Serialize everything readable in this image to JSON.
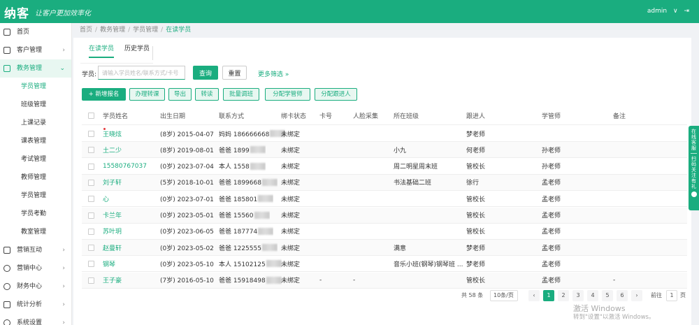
{
  "header": {
    "logo": "纳客",
    "slogan": "让客户更加效率化",
    "user": "admin",
    "user_arrow": "∨",
    "exit_icon": "⇥"
  },
  "sidebar": [
    {
      "label": "首页",
      "icon": "home-icon",
      "arrow": ""
    },
    {
      "label": "客户管理",
      "icon": "customer-icon",
      "arrow": "›"
    },
    {
      "label": "教务管理",
      "icon": "education-icon",
      "arrow": "⌄",
      "open": true,
      "children": [
        "学员管理",
        "班级管理",
        "上课记录",
        "课表管理",
        "考试管理",
        "教师管理",
        "学员管理",
        "学员考勤",
        "教室管理"
      ]
    },
    {
      "label": "营销互动",
      "icon": "marketing-icon",
      "arrow": "›"
    },
    {
      "label": "营销中心",
      "icon": "gift-icon",
      "arrow": "›"
    },
    {
      "label": "财务中心",
      "icon": "finance-icon",
      "arrow": "›"
    },
    {
      "label": "统计分析",
      "icon": "chart-icon",
      "arrow": "›"
    },
    {
      "label": "系统设置",
      "icon": "settings-icon",
      "arrow": "›"
    }
  ],
  "breadcrumb": [
    "首页",
    "教务管理",
    "学员管理",
    "在读学员"
  ],
  "tabs": [
    "在读学员",
    "历史学员"
  ],
  "search": {
    "label": "学员:",
    "placeholder": "请输入学员姓名/联系方式/卡号",
    "query": "查询",
    "reset": "重置",
    "more": "更多筛选 »"
  },
  "actions": [
    "+ 新增报名",
    "办理转课",
    "导出",
    "转读",
    "批量调班",
    "分配学管师",
    "分配跟进人"
  ],
  "columns": [
    "学员姓名",
    "出生日期",
    "联系方式",
    "绑卡状态",
    "卡号",
    "人脸采集",
    "所在班级",
    "跟进人",
    "学管师",
    "备注"
  ],
  "rows": [
    {
      "name": "王晓炫",
      "birth": "(8岁) 2015-04-07",
      "contact": "妈妈 186666668",
      "bind": "未绑定",
      "card": "",
      "face": "",
      "class": "",
      "follow": "梦老师",
      "manager": "",
      "remark": ""
    },
    {
      "name": "土二少",
      "birth": "(8岁) 2019-08-01",
      "contact": "爸爸 1899",
      "bind": "未绑定",
      "card": "",
      "face": "",
      "class": "小九",
      "follow": "何老师",
      "manager": "孙老师",
      "remark": ""
    },
    {
      "name": "15580767037",
      "birth": "(0岁) 2023-07-04",
      "contact": "本人 1558",
      "bind": "未绑定",
      "card": "",
      "face": "",
      "class": "周二明星周末班",
      "follow": "管校长",
      "manager": "孙老师",
      "remark": ""
    },
    {
      "name": "刘子轩",
      "birth": "(5岁) 2018-10-01",
      "contact": "爸爸 1899668",
      "bind": "未绑定",
      "card": "",
      "face": "",
      "class": "书法基础二班",
      "follow": "徐行",
      "manager": "孟老师",
      "remark": ""
    },
    {
      "name": "心",
      "birth": "(0岁) 2023-07-01",
      "contact": "爸爸 185801",
      "bind": "未绑定",
      "card": "",
      "face": "",
      "class": "",
      "follow": "管校长",
      "manager": "孟老师",
      "remark": ""
    },
    {
      "name": "卡兰年",
      "birth": "(0岁) 2023-05-01",
      "contact": "爸爸 15560",
      "bind": "未绑定",
      "card": "",
      "face": "",
      "class": "",
      "follow": "管校长",
      "manager": "孟老师",
      "remark": ""
    },
    {
      "name": "苏叶玥",
      "birth": "(0岁) 2023-06-05",
      "contact": "爸爸 187774",
      "bind": "未绑定",
      "card": "",
      "face": "",
      "class": "",
      "follow": "管校长",
      "manager": "孟老师",
      "remark": ""
    },
    {
      "name": "赵曼轩",
      "birth": "(0岁) 2023-05-02",
      "contact": "爸爸 1225555",
      "bind": "未绑定",
      "card": "",
      "face": "",
      "class": "满意",
      "follow": "梦老师",
      "manager": "孟老师",
      "remark": ""
    },
    {
      "name": "钢琴",
      "birth": "(0岁) 2023-05-10",
      "contact": "本人 15102125",
      "bind": "未绑定",
      "card": "",
      "face": "",
      "class": "音乐小班(钢琴)钢琴班 ...",
      "follow": "梦老师",
      "manager": "孟老师",
      "remark": ""
    },
    {
      "name": "王子豪",
      "birth": "(7岁) 2016-05-10",
      "contact": "爸爸 15918498",
      "bind": "未绑定",
      "card": "-",
      "face": "-",
      "class": "",
      "follow": "管校长",
      "manager": "孟老师",
      "remark": "-"
    }
  ],
  "pager": {
    "total": "共 58 条",
    "size": "10条/页",
    "prev": "‹",
    "pages": [
      "1",
      "2",
      "3",
      "4",
      "5",
      "6"
    ],
    "next": "›",
    "goto": "前往",
    "jump": "1",
    "unit": "页"
  },
  "float": {
    "top": "在线客服",
    "bottom": "扫码关注有礼"
  },
  "watermark": {
    "line1": "激活 Windows",
    "line2": "转到\"设置\"以激活 Windows。"
  }
}
